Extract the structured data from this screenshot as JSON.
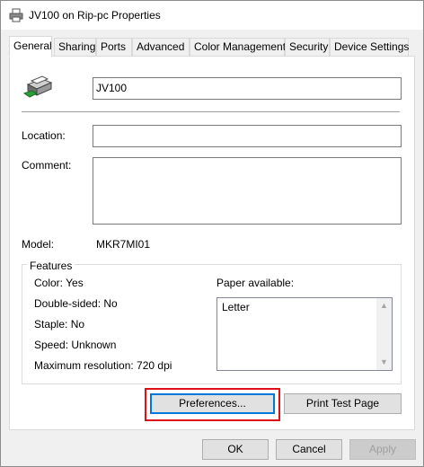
{
  "window": {
    "title": "JV100 on Rip-pc Properties",
    "icon": "printer-icon"
  },
  "tabs": [
    {
      "label": "General",
      "active": true
    },
    {
      "label": "Sharing"
    },
    {
      "label": "Ports"
    },
    {
      "label": "Advanced"
    },
    {
      "label": "Color Management"
    },
    {
      "label": "Security"
    },
    {
      "label": "Device Settings"
    }
  ],
  "general": {
    "printer_name": "JV100",
    "location_label": "Location:",
    "location_value": "",
    "comment_label": "Comment:",
    "comment_value": "",
    "model_label": "Model:",
    "model_value": "MKR7MI01"
  },
  "features": {
    "title": "Features",
    "color": "Color: Yes",
    "double_sided": "Double-sided: No",
    "staple": "Staple: No",
    "speed": "Speed: Unknown",
    "max_resolution": "Maximum resolution: 720 dpi",
    "paper_label": "Paper available:",
    "paper_items": [
      "Letter"
    ]
  },
  "buttons": {
    "preferences": "Preferences...",
    "print_test_page": "Print Test Page",
    "ok": "OK",
    "cancel": "Cancel",
    "apply": "Apply"
  },
  "colors": {
    "highlight": "#e0101a",
    "focus": "#0078d7"
  }
}
